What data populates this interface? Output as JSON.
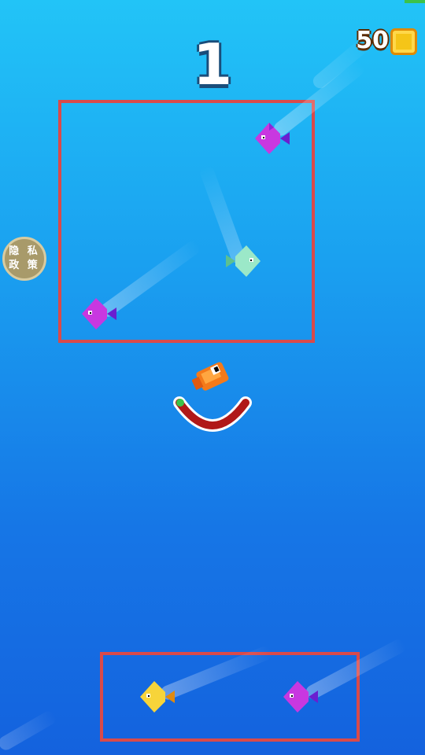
{
  "hud": {
    "score": "1",
    "coins": "50"
  },
  "privacy_button": {
    "label_line1": "隐 私",
    "label_line2": "政 策"
  },
  "colors": {
    "zone_border": "#d94a4a",
    "fish_purple": "#c838e0",
    "fish_mint": "#9be8c8",
    "fish_yellow": "#f7d43a",
    "player_orange": "#f47a1a",
    "arc_red": "#b01818"
  },
  "fish": [
    {
      "name": "fish-purple-top",
      "color": "purple"
    },
    {
      "name": "fish-mint",
      "color": "mint"
    },
    {
      "name": "fish-purple-left",
      "color": "purple"
    },
    {
      "name": "fish-yellow",
      "color": "yellow"
    },
    {
      "name": "fish-purple-bottom",
      "color": "purple"
    }
  ]
}
